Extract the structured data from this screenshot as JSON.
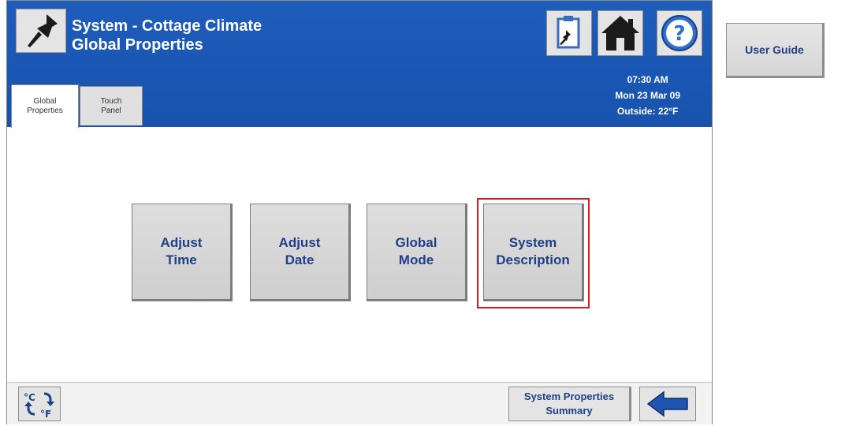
{
  "header": {
    "title_line1": "System - Cottage Climate",
    "title_line2": "Global Properties",
    "time": "07:30 AM",
    "date": "Mon 23 Mar 09",
    "outside": "Outside: 22°F",
    "icons": [
      "pushpin-icon",
      "clipboard-icon",
      "home-icon",
      "help-icon"
    ]
  },
  "tabs": [
    {
      "label": "Global\nProperties",
      "active": true
    },
    {
      "label": "Touch\nPanel",
      "active": false
    }
  ],
  "main": {
    "buttons": [
      {
        "label": "Adjust\nTime"
      },
      {
        "label": "Adjust\nDate"
      },
      {
        "label": "Global\nMode"
      },
      {
        "label": "System\nDescription",
        "highlighted": true
      }
    ]
  },
  "footer": {
    "unit_toggle": {
      "c": "°C",
      "f": "°F"
    },
    "summary_label": "System Properties\nSummary"
  },
  "sidebar": {
    "user_guide_label": "User Guide"
  },
  "colors": {
    "header_blue": "#1a56b3",
    "label_blue": "#1f3f86",
    "highlight_red": "#d51f1f"
  }
}
